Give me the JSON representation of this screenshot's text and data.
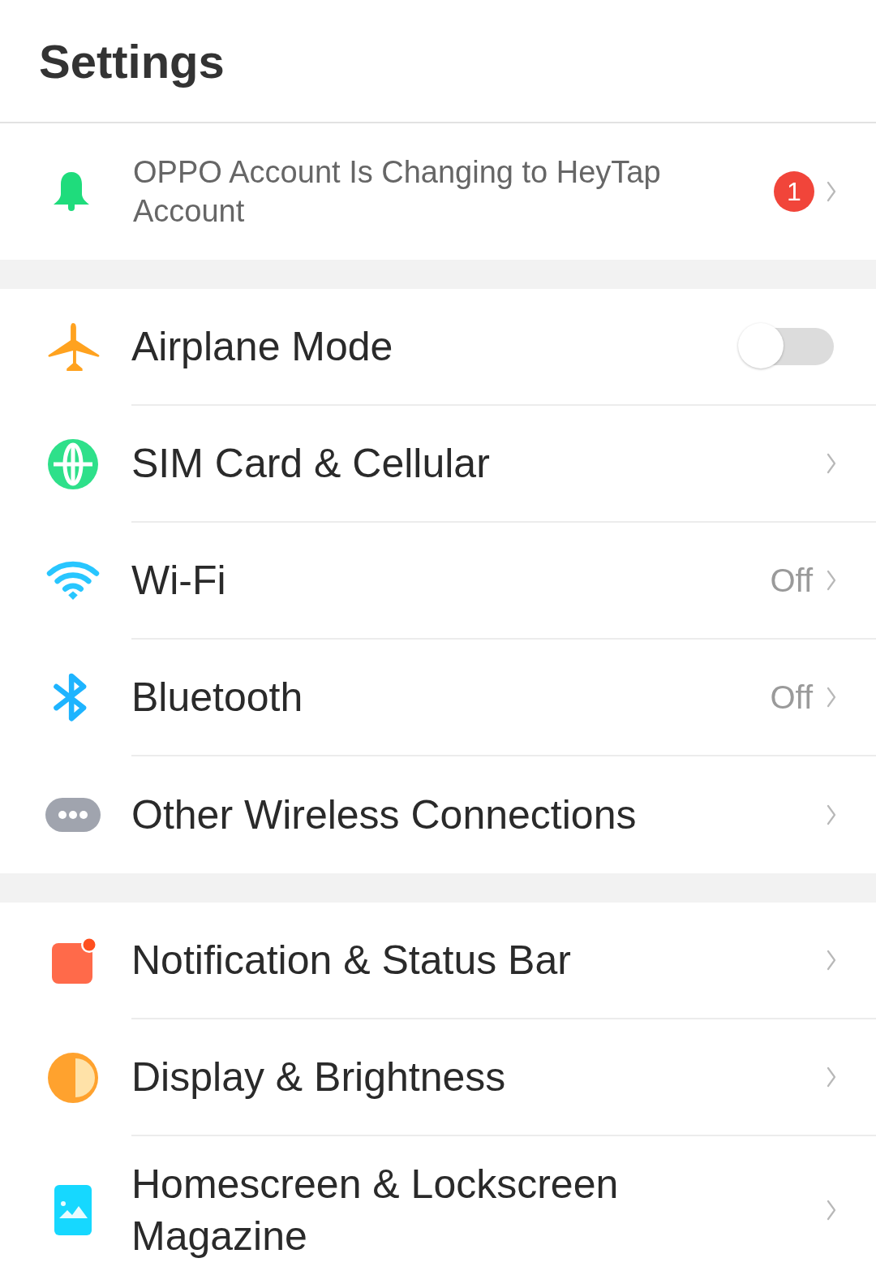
{
  "title": "Settings",
  "notice": {
    "text": "OPPO Account Is Changing to HeyTap Account",
    "badge": "1"
  },
  "groups": [
    {
      "items": [
        {
          "kind": "toggle",
          "label": "Airplane Mode",
          "on": false
        },
        {
          "kind": "link",
          "label": "SIM Card & Cellular"
        },
        {
          "kind": "link",
          "label": "Wi-Fi",
          "value": "Off"
        },
        {
          "kind": "link",
          "label": "Bluetooth",
          "value": "Off"
        },
        {
          "kind": "link",
          "label": "Other Wireless Connections"
        }
      ]
    },
    {
      "items": [
        {
          "kind": "link",
          "label": "Notification & Status Bar"
        },
        {
          "kind": "link",
          "label": "Display & Brightness"
        },
        {
          "kind": "link",
          "label": "Homescreen & Lockscreen Magazine"
        }
      ]
    }
  ]
}
